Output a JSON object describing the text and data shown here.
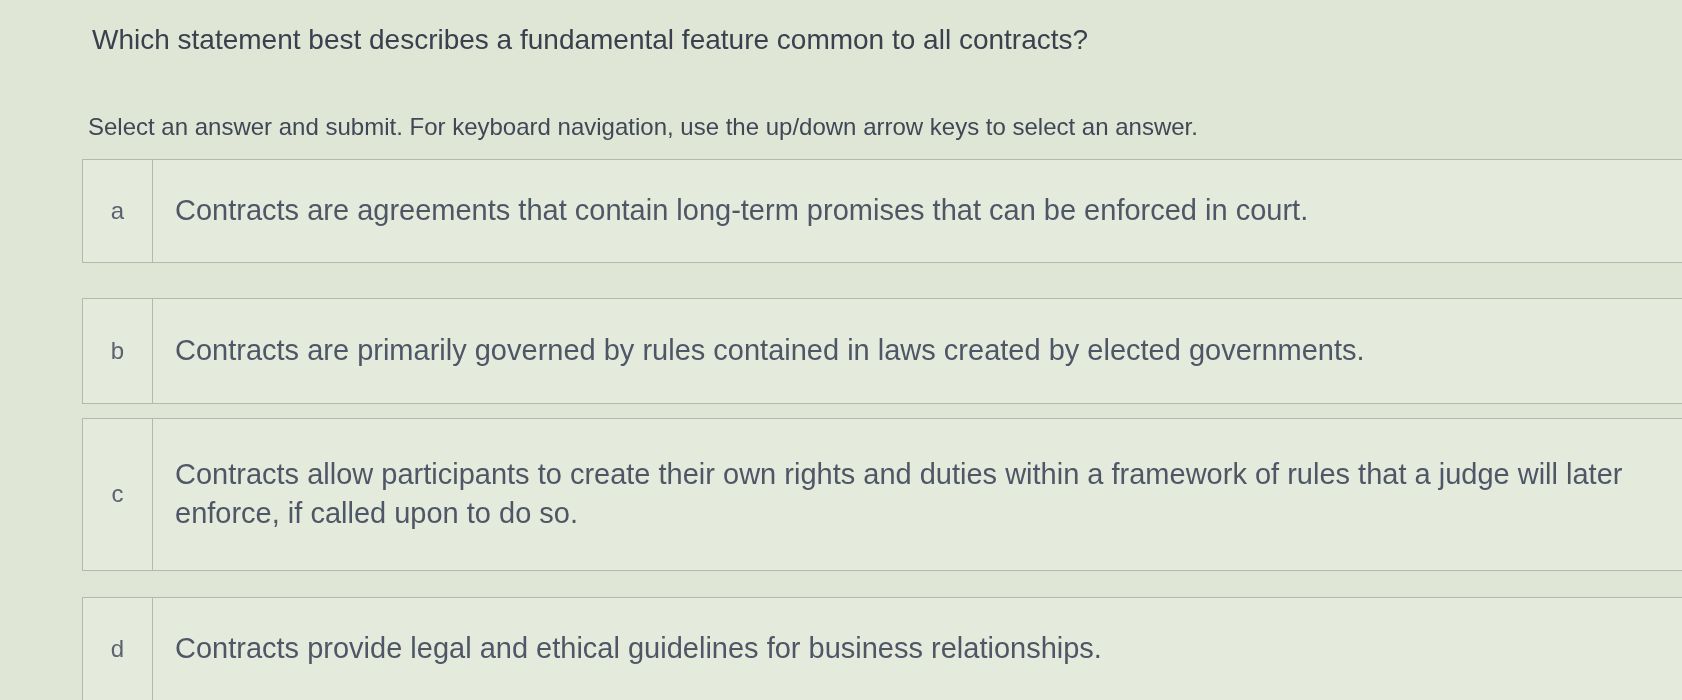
{
  "question": "Which statement best describes a fundamental feature common to all contracts?",
  "instruction": "Select an answer and submit. For keyboard navigation, use the up/down arrow keys to select an answer.",
  "options": [
    {
      "letter": "a",
      "text": "Contracts are agreements that contain long-term promises that can be enforced in court.",
      "selected": false
    },
    {
      "letter": "b",
      "text": "Contracts are primarily governed by rules contained in laws created by elected governments.",
      "selected": false
    },
    {
      "letter": "c",
      "text": "Contracts allow participants to create their own rights and duties within a framework of rules that a judge will later enforce, if called upon to do so.",
      "selected": false
    },
    {
      "letter": "d",
      "text": "Contracts provide legal and ethical guidelines for business relationships.",
      "selected": false
    }
  ]
}
